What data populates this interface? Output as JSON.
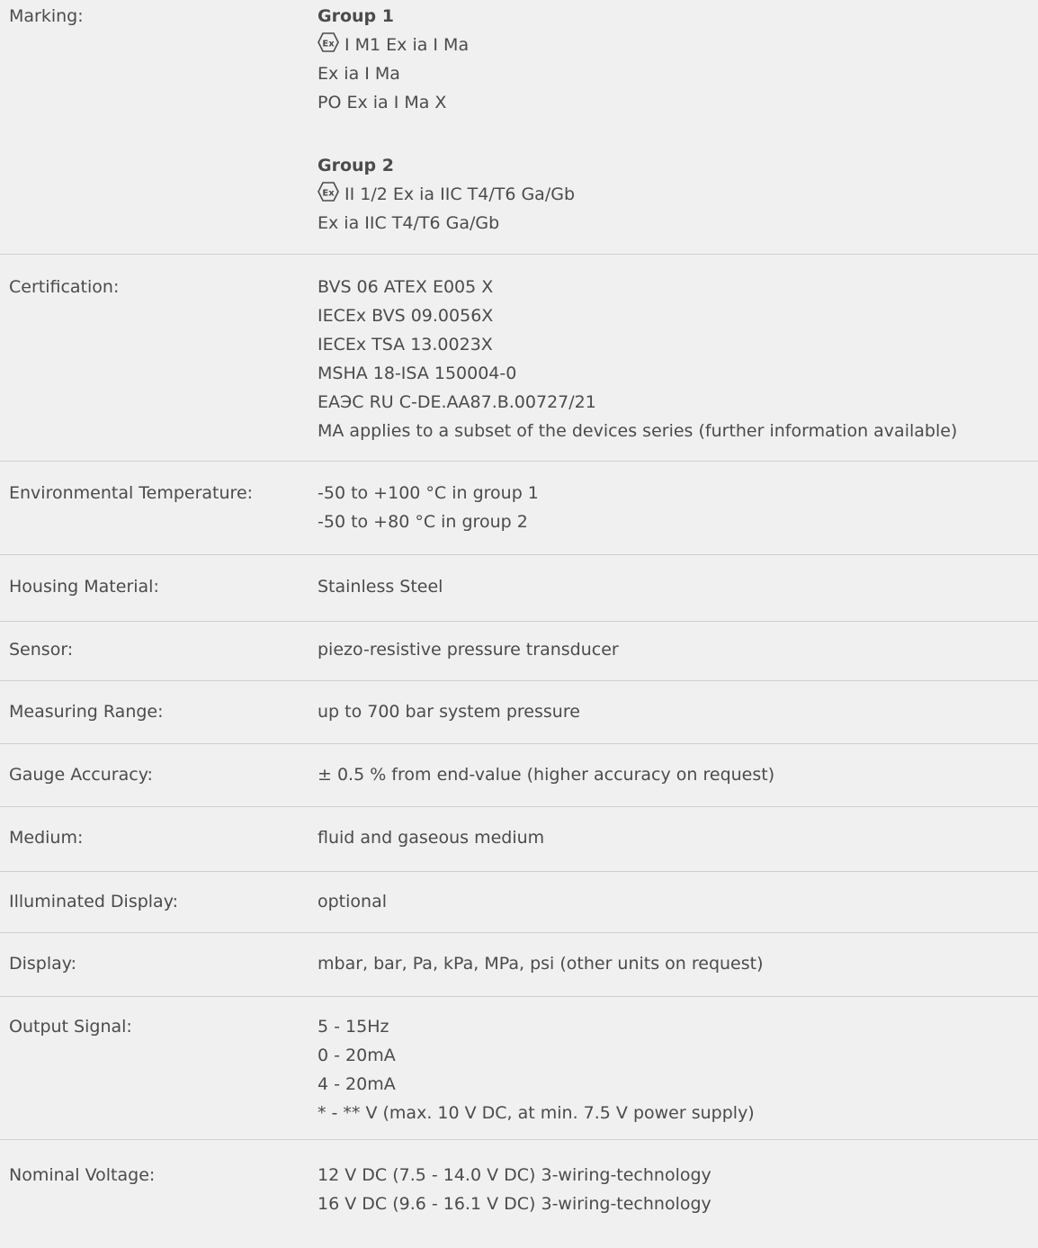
{
  "rows": {
    "marking": {
      "label": "Marking:",
      "groups": [
        {
          "title": "Group 1",
          "icon": "ex-hexagon-icon",
          "lines": [
            "I M1 Ex ia I Ma",
            "Ex ia I Ma",
            "PO Ex ia I Ma X"
          ]
        },
        {
          "title": "Group 2",
          "icon": "ex-hexagon-icon",
          "lines": [
            "II 1/2 Ex ia IIC T4/T6 Ga/Gb",
            "Ex ia IIC T4/T6 Ga/Gb"
          ]
        }
      ]
    },
    "certification": {
      "label": "Certification:",
      "lines": [
        "BVS 06 ATEX E005 X",
        "IECEx BVS 09.0056X",
        "IECEx TSA 13.0023X",
        "MSHA 18-ISA 150004-0",
        "ЕАЭС RU С-DE.АА87.В.00727/21",
        "MA applies to a subset of the devices series (further information available)"
      ]
    },
    "environmental_temperature": {
      "label": "Environmental Temperature:",
      "lines": [
        "-50 to +100 °C in group 1",
        "-50 to +80 °C in group  2"
      ]
    },
    "housing_material": {
      "label": "Housing Material:",
      "lines": [
        "Stainless Steel"
      ]
    },
    "sensor": {
      "label": "Sensor:",
      "lines": [
        "piezo-resistive pressure transducer"
      ]
    },
    "measuring_range": {
      "label": "Measuring Range:",
      "lines": [
        "up to 700 bar system pressure"
      ]
    },
    "gauge_accuracy": {
      "label": "Gauge Accuracy:",
      "lines": [
        "± 0.5 % from end-value (higher accuracy on request)"
      ]
    },
    "medium": {
      "label": "Medium:",
      "lines": [
        "fluid and gaseous medium"
      ]
    },
    "illuminated_display": {
      "label": "Illuminated Display:",
      "lines": [
        "optional"
      ]
    },
    "display": {
      "label": "Display:",
      "lines": [
        "mbar, bar, Pa, kPa, MPa, psi (other units on request)"
      ]
    },
    "output_signal": {
      "label": "Output Signal:",
      "lines": [
        "5 - 15Hz",
        "0 - 20mA",
        "4 - 20mA",
        "* - ** V (max. 10 V DC, at min. 7.5 V power supply)"
      ]
    },
    "nominal_voltage": {
      "label": "Nominal Voltage:",
      "lines": [
        "12 V DC (7.5 - 14.0 V DC) 3-wiring-technology",
        "16 V DC (9.6 - 16.1 V DC) 3-wiring-technology"
      ]
    }
  },
  "colors": {
    "background": "#f0f0f0",
    "text": "#4b4b4b",
    "divider": "#cfcfcf"
  }
}
